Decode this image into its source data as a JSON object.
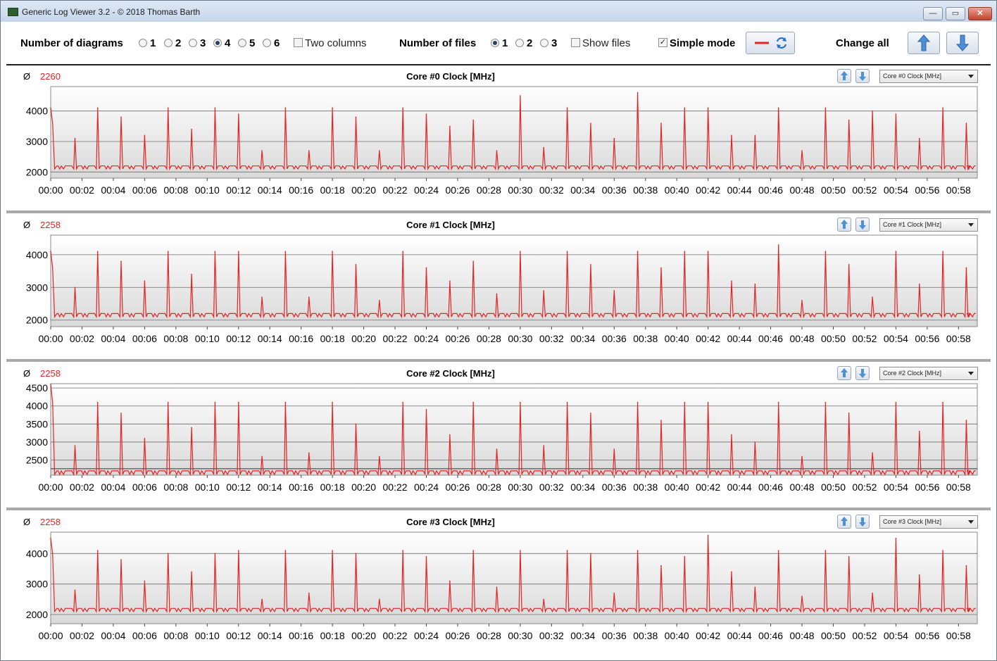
{
  "window": {
    "title": "Generic Log Viewer 3.2 - © 2018 Thomas Barth"
  },
  "toolbar": {
    "num_diagrams_label": "Number of diagrams",
    "diagram_options": [
      "1",
      "2",
      "3",
      "4",
      "5",
      "6"
    ],
    "diagram_selected": "4",
    "two_columns_label": "Two columns",
    "two_columns_checked": false,
    "num_files_label": "Number of files",
    "file_options": [
      "1",
      "2",
      "3"
    ],
    "file_selected": "1",
    "show_files_label": "Show files",
    "show_files_checked": false,
    "simple_mode_label": "Simple mode",
    "simple_mode_checked": true,
    "change_all_label": "Change all",
    "icons": [
      "red-line-icon",
      "refresh-icon",
      "arrow-up-icon",
      "arrow-down-icon"
    ]
  },
  "colors": {
    "series": "#e52222",
    "avg_text": "#e52222"
  },
  "diagrams": [
    {
      "avg_symbol": "Ø",
      "avg_value": "2260",
      "title": "Core #0 Clock [MHz]",
      "selector": "Core #0 Clock [MHz]"
    },
    {
      "avg_symbol": "Ø",
      "avg_value": "2258",
      "title": "Core #1 Clock [MHz]",
      "selector": "Core #1 Clock [MHz]"
    },
    {
      "avg_symbol": "Ø",
      "avg_value": "2258",
      "title": "Core #2 Clock [MHz]",
      "selector": "Core #2 Clock [MHz]"
    },
    {
      "avg_symbol": "Ø",
      "avg_value": "2258",
      "title": "Core #3 Clock [MHz]",
      "selector": "Core #3 Clock [MHz]"
    }
  ],
  "chart_data": [
    {
      "type": "line",
      "title": "Core #0 Clock [MHz]",
      "x_unit": "minutes",
      "x_ticks": [
        "00:00",
        "00:02",
        "00:04",
        "00:06",
        "00:08",
        "00:10",
        "00:12",
        "00:14",
        "00:16",
        "00:18",
        "00:20",
        "00:22",
        "00:24",
        "00:26",
        "00:28",
        "00:30",
        "00:32",
        "00:34",
        "00:36",
        "00:38",
        "00:40",
        "00:42",
        "00:44",
        "00:46",
        "00:48",
        "00:50",
        "00:52",
        "00:54",
        "00:56",
        "00:58"
      ],
      "y_ticks": [
        2000,
        3000,
        4000
      ],
      "ylim": [
        1800,
        4800
      ],
      "xlim": [
        0,
        59.2
      ],
      "baseline": 2200,
      "series": [
        {
          "name": "Core #0 Clock [MHz]",
          "color": "#e52222",
          "spikes": [
            [
              0,
              4100
            ],
            [
              1.55,
              3100
            ],
            [
              3.0,
              4100
            ],
            [
              4.5,
              3800
            ],
            [
              6.0,
              3200
            ],
            [
              7.5,
              4100
            ],
            [
              9.0,
              3400
            ],
            [
              10.5,
              4100
            ],
            [
              12.0,
              3900
            ],
            [
              13.5,
              2700
            ],
            [
              15.0,
              4100
            ],
            [
              16.5,
              2700
            ],
            [
              18.0,
              4100
            ],
            [
              19.5,
              3800
            ],
            [
              21.0,
              2700
            ],
            [
              22.5,
              4100
            ],
            [
              24.0,
              3900
            ],
            [
              25.5,
              3500
            ],
            [
              27.0,
              3700
            ],
            [
              28.5,
              2700
            ],
            [
              30.0,
              4500
            ],
            [
              31.5,
              2800
            ],
            [
              33.0,
              4100
            ],
            [
              34.5,
              3600
            ],
            [
              36.0,
              3100
            ],
            [
              37.5,
              4600
            ],
            [
              39.0,
              3600
            ],
            [
              40.5,
              4100
            ],
            [
              42.0,
              4100
            ],
            [
              43.5,
              3200
            ],
            [
              45.0,
              3200
            ],
            [
              46.5,
              4100
            ],
            [
              48.0,
              2700
            ],
            [
              49.5,
              4100
            ],
            [
              51.0,
              3700
            ],
            [
              52.5,
              4000
            ],
            [
              54.0,
              3900
            ],
            [
              55.5,
              3100
            ],
            [
              57.0,
              4100
            ],
            [
              58.5,
              3600
            ]
          ]
        }
      ]
    },
    {
      "type": "line",
      "title": "Core #1 Clock [MHz]",
      "x_unit": "minutes",
      "x_ticks": [
        "00:00",
        "00:02",
        "00:04",
        "00:06",
        "00:08",
        "00:10",
        "00:12",
        "00:14",
        "00:16",
        "00:18",
        "00:20",
        "00:22",
        "00:24",
        "00:26",
        "00:28",
        "00:30",
        "00:32",
        "00:34",
        "00:36",
        "00:38",
        "00:40",
        "00:42",
        "00:44",
        "00:46",
        "00:48",
        "00:50",
        "00:52",
        "00:54",
        "00:56",
        "00:58"
      ],
      "y_ticks": [
        2000,
        3000,
        4000
      ],
      "ylim": [
        1800,
        4600
      ],
      "xlim": [
        0,
        59.2
      ],
      "baseline": 2200,
      "series": [
        {
          "name": "Core #1 Clock [MHz]",
          "color": "#e52222",
          "spikes": [
            [
              0,
              4100
            ],
            [
              1.55,
              3000
            ],
            [
              3.0,
              4100
            ],
            [
              4.5,
              3800
            ],
            [
              6.0,
              3200
            ],
            [
              7.5,
              4100
            ],
            [
              9.0,
              3400
            ],
            [
              10.5,
              4100
            ],
            [
              12.0,
              4100
            ],
            [
              13.5,
              2700
            ],
            [
              15.0,
              4100
            ],
            [
              16.5,
              2700
            ],
            [
              18.0,
              4100
            ],
            [
              19.5,
              3700
            ],
            [
              21.0,
              2600
            ],
            [
              22.5,
              4100
            ],
            [
              24.0,
              3600
            ],
            [
              25.5,
              3200
            ],
            [
              27.0,
              3800
            ],
            [
              28.5,
              2800
            ],
            [
              30.0,
              4100
            ],
            [
              31.5,
              2900
            ],
            [
              33.0,
              4100
            ],
            [
              34.5,
              3700
            ],
            [
              36.0,
              2900
            ],
            [
              37.5,
              4100
            ],
            [
              39.0,
              3600
            ],
            [
              40.5,
              4100
            ],
            [
              42.0,
              4100
            ],
            [
              43.5,
              3200
            ],
            [
              45.0,
              3100
            ],
            [
              46.5,
              4300
            ],
            [
              48.0,
              2600
            ],
            [
              49.5,
              4100
            ],
            [
              51.0,
              3700
            ],
            [
              52.5,
              2700
            ],
            [
              54.0,
              4100
            ],
            [
              55.5,
              3100
            ],
            [
              57.0,
              4100
            ],
            [
              58.5,
              3600
            ]
          ]
        }
      ]
    },
    {
      "type": "line",
      "title": "Core #2 Clock [MHz]",
      "x_unit": "minutes",
      "x_ticks": [
        "00:00",
        "00:02",
        "00:04",
        "00:06",
        "00:08",
        "00:10",
        "00:12",
        "00:14",
        "00:16",
        "00:18",
        "00:20",
        "00:22",
        "00:24",
        "00:26",
        "00:28",
        "00:30",
        "00:32",
        "00:34",
        "00:36",
        "00:38",
        "00:40",
        "00:42",
        "00:44",
        "00:46",
        "00:48",
        "00:50",
        "00:52",
        "00:54",
        "00:56",
        "00:58"
      ],
      "y_ticks": [
        2500,
        3000,
        3500,
        4000,
        4500
      ],
      "ylim": [
        2080,
        4620
      ],
      "xlim": [
        0,
        59.2
      ],
      "baseline": 2200,
      "avg_line": 2258,
      "series": [
        {
          "name": "Core #2 Clock [MHz]",
          "color": "#e52222",
          "spikes": [
            [
              0,
              4600
            ],
            [
              1.55,
              2900
            ],
            [
              3.0,
              4100
            ],
            [
              4.5,
              3800
            ],
            [
              6.0,
              3100
            ],
            [
              7.5,
              4100
            ],
            [
              9.0,
              3400
            ],
            [
              10.5,
              4100
            ],
            [
              12.0,
              4100
            ],
            [
              13.5,
              2600
            ],
            [
              15.0,
              4100
            ],
            [
              16.5,
              2700
            ],
            [
              18.0,
              4100
            ],
            [
              19.5,
              3500
            ],
            [
              21.0,
              2600
            ],
            [
              22.5,
              4100
            ],
            [
              24.0,
              3900
            ],
            [
              25.5,
              3200
            ],
            [
              27.0,
              4100
            ],
            [
              28.5,
              2800
            ],
            [
              30.0,
              4100
            ],
            [
              31.5,
              2900
            ],
            [
              33.0,
              4100
            ],
            [
              34.5,
              3800
            ],
            [
              36.0,
              2800
            ],
            [
              37.5,
              4100
            ],
            [
              39.0,
              3600
            ],
            [
              40.5,
              4100
            ],
            [
              42.0,
              4100
            ],
            [
              43.5,
              3200
            ],
            [
              45.0,
              3000
            ],
            [
              46.5,
              4100
            ],
            [
              48.0,
              2600
            ],
            [
              49.5,
              4100
            ],
            [
              51.0,
              3800
            ],
            [
              52.5,
              2700
            ],
            [
              54.0,
              4100
            ],
            [
              55.5,
              3300
            ],
            [
              57.0,
              4100
            ],
            [
              58.5,
              3600
            ]
          ]
        }
      ]
    },
    {
      "type": "line",
      "title": "Core #3 Clock [MHz]",
      "x_unit": "minutes",
      "x_ticks": [
        "00:00",
        "00:02",
        "00:04",
        "00:06",
        "00:08",
        "00:10",
        "00:12",
        "00:14",
        "00:16",
        "00:18",
        "00:20",
        "00:22",
        "00:24",
        "00:26",
        "00:28",
        "00:30",
        "00:32",
        "00:34",
        "00:36",
        "00:38",
        "00:40",
        "00:42",
        "00:44",
        "00:46",
        "00:48",
        "00:50",
        "00:52",
        "00:54",
        "00:56",
        "00:58"
      ],
      "y_ticks": [
        2000,
        3000,
        4000
      ],
      "ylim": [
        1700,
        4700
      ],
      "xlim": [
        0,
        59.2
      ],
      "baseline": 2200,
      "series": [
        {
          "name": "Core #3 Clock [MHz]",
          "color": "#e52222",
          "spikes": [
            [
              0,
              4500
            ],
            [
              1.55,
              2800
            ],
            [
              3.0,
              4100
            ],
            [
              4.5,
              3800
            ],
            [
              6.0,
              3100
            ],
            [
              7.5,
              4000
            ],
            [
              9.0,
              3400
            ],
            [
              10.5,
              4000
            ],
            [
              12.0,
              4100
            ],
            [
              13.5,
              2500
            ],
            [
              15.0,
              4100
            ],
            [
              16.5,
              2700
            ],
            [
              18.0,
              4100
            ],
            [
              19.5,
              4000
            ],
            [
              21.0,
              2500
            ],
            [
              22.5,
              4100
            ],
            [
              24.0,
              3900
            ],
            [
              25.5,
              3100
            ],
            [
              27.0,
              4100
            ],
            [
              28.5,
              2900
            ],
            [
              30.0,
              4100
            ],
            [
              31.5,
              2500
            ],
            [
              33.0,
              4100
            ],
            [
              34.5,
              4000
            ],
            [
              36.0,
              2700
            ],
            [
              37.5,
              4100
            ],
            [
              39.0,
              3600
            ],
            [
              40.5,
              3900
            ],
            [
              42.0,
              4600
            ],
            [
              43.5,
              3400
            ],
            [
              45.0,
              2900
            ],
            [
              46.5,
              4100
            ],
            [
              48.0,
              2600
            ],
            [
              49.5,
              4100
            ],
            [
              51.0,
              3900
            ],
            [
              52.5,
              2700
            ],
            [
              54.0,
              4500
            ],
            [
              55.5,
              3300
            ],
            [
              57.0,
              4100
            ],
            [
              58.5,
              3600
            ]
          ]
        }
      ]
    }
  ]
}
